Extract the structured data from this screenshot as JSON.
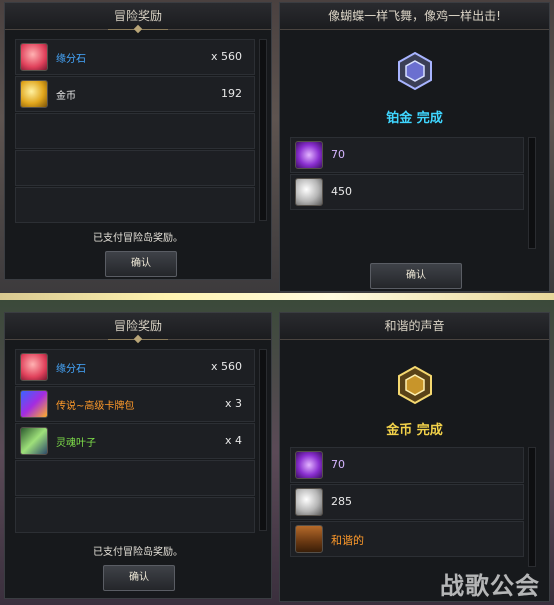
{
  "top_left": {
    "title": "冒险奖励",
    "items": [
      {
        "name": "缘分石",
        "qty": "x 560",
        "color": "#46a8ff",
        "icon": "heart-stone-icon"
      },
      {
        "name": "金币",
        "qty": "192",
        "color": "#e8e8e8",
        "icon": "gold-coin-icon"
      }
    ],
    "status": "已支付冒险岛奖励。",
    "confirm": "确认"
  },
  "top_right": {
    "title": "像蝴蝶一样飞舞，像鸡一样出击!",
    "rank": "铂金 完成",
    "rank_color": "#3fd6ff",
    "items": [
      {
        "qty": "70",
        "color": "#d6b6ff",
        "icon": "purple-crystal-icon"
      },
      {
        "qty": "450",
        "color": "#e8e8e8",
        "icon": "silver-coin-icon"
      }
    ],
    "confirm": "确认"
  },
  "bottom_left": {
    "title": "冒险奖励",
    "items": [
      {
        "name": "缘分石",
        "qty": "x 560",
        "color": "#46a8ff",
        "icon": "heart-stone-icon"
      },
      {
        "name": "传说~高级卡牌包",
        "qty": "x 3",
        "color": "#ff9a2a",
        "icon": "card-pack-icon"
      },
      {
        "name": "灵魂叶子",
        "qty": "x 4",
        "color": "#7fe04a",
        "icon": "soul-leaf-icon"
      }
    ],
    "status": "已支付冒险岛奖励。",
    "confirm": "确认"
  },
  "bottom_right": {
    "title": "和谐的声音",
    "rank": "金币 完成",
    "rank_color": "#f3d24a",
    "items": [
      {
        "qty": "70",
        "color": "#d6b6ff",
        "icon": "purple-crystal-icon"
      },
      {
        "qty": "285",
        "color": "#e8e8e8",
        "icon": "silver-coin-icon"
      },
      {
        "qty": "和谐的",
        "color": "#ff9a2a",
        "icon": "treasure-chest-icon"
      }
    ]
  },
  "watermark": "战歌公会"
}
